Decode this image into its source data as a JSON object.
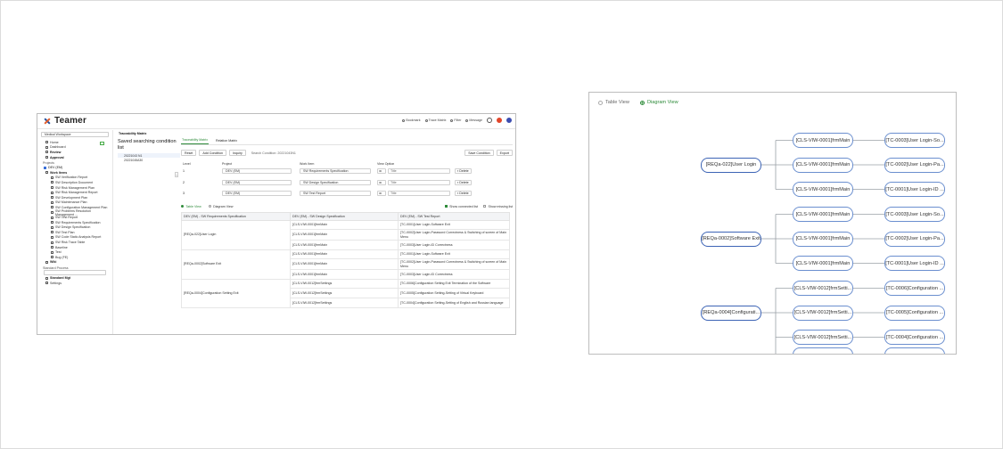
{
  "app": {
    "logo_text": "Teamer",
    "top_nav": [
      "Bookmark",
      "Trace Matrix",
      "Filter",
      "Message"
    ],
    "workspace": "Medical Workspace",
    "nav": [
      "Home",
      "Dashboard",
      "Review",
      "Approval"
    ],
    "projects_label": "Projects",
    "project_name": "DEV (EM)",
    "work_items_label": "Work Items",
    "work_items": [
      "SW Verification Report",
      "SW Description Document",
      "SW Risk Management Plan",
      "SW Risk Management Report",
      "SW Development Plan",
      "SW Maintenance Plan",
      "SW Configuration Management Plan",
      "SW Problems Resolution Management ...",
      "SW Test Report",
      "SW Requirements Specification",
      "SW Design Specification",
      "SW Test Plan",
      "SW Code Static Analysis Report",
      "SW Risk Trace Table",
      "Baseline",
      "Test",
      "Bug (FE)"
    ],
    "wiki": "Wiki",
    "std_process": "Standard Process",
    "std_select": "",
    "std_mgt": "Standard Mgt",
    "settings": "Settings",
    "breadcrumb": "Traceability Matrix",
    "saved": {
      "title": "Saved searching condition list",
      "items": [
        "20221043 N1",
        "20221045A30"
      ]
    },
    "tabs": [
      "Traceability Matrix",
      "Relation Matrix"
    ],
    "buttons": {
      "reset": "Reset",
      "add": "Add Condition",
      "inquiry": "Inquiry",
      "save": "Save Condition",
      "export": "Export"
    },
    "search_condition": "Search Condition: 20221043N1",
    "grid_headers": [
      "Level",
      "Project",
      "Work Item",
      "View Option"
    ],
    "grid_rows": [
      {
        "level": "1",
        "project": "DEV (EM)",
        "work": "SW Requirements Specification",
        "opt": "ID",
        "view": "Title",
        "del": "Delete"
      },
      {
        "level": "2",
        "project": "DEV (EM)",
        "work": "SW Design Specification",
        "opt": "ID",
        "view": "Title",
        "del": "Delete"
      },
      {
        "level": "3",
        "project": "DEV (EM)",
        "work": "SW Test Report",
        "opt": "ID",
        "view": "Title",
        "del": "Delete"
      }
    ],
    "view_toggle": {
      "table": "Table View",
      "diagram": "Diagram View",
      "connected": "Show connected list",
      "missing": "Show missing list"
    },
    "table_headers": [
      "DEV (EM) - SW Requirements Specification",
      "DEV (EM) - SW Design Specification",
      "DEV (EM) - SW Test Report"
    ],
    "table_groups": [
      {
        "req": "[REQa-022]User Login",
        "rows": [
          [
            "[CLS-VIW-0001]frmMain",
            "[TC-0001]User Login-Software Exit"
          ],
          [
            "[CLS-VIW-0001]frmMain",
            "[TC-0002]User Login-Password Correctness & Switching of screen of Main Menu"
          ],
          [
            "[CLS-VIW-0001]frmMain",
            "[TC-0003]User Login-ID Correctness"
          ]
        ]
      },
      {
        "req": "[REQa-0002]Software Exit",
        "rows": [
          [
            "[CLS-VIW-0001]frmMain",
            "[TC-0001]User Login-Software Exit"
          ],
          [
            "[CLS-VIW-0001]frmMain",
            "[TC-0002]User Login-Password Correctness & Switching of screen of Main Menu"
          ],
          [
            "[CLS-VIW-0001]frmMain",
            "[TC-0003]User Login-ID Correctness"
          ]
        ]
      },
      {
        "req": "[REQa-0004]Configuration Setting Exit",
        "rows": [
          [
            "[CLS-VIW-0012]frmSettings",
            "[TC-0006]Configuration Setting Exit Termination of the Software"
          ],
          [
            "[CLS-VIW-0012]frmSettings",
            "[TC-0005]Configuration Setting-Setting of Virtual Keyboard"
          ],
          [
            "[CLS-VIW-0012]frmSettings",
            "[TC-0004]Configuration Setting-Setting of English and Russian language"
          ]
        ]
      }
    ]
  },
  "diagram": {
    "view_toggle": {
      "table": "Table View",
      "diagram": "Diagram View"
    },
    "groups": [
      {
        "req": "[REQa-022]User Login",
        "cls": [
          "[CLS-VIW-0001]frmMain",
          "[CLS-VIW-0001]frmMain",
          "[CLS-VIW-0001]frmMain"
        ],
        "tc": [
          "[TC-0003]User Login-So...",
          "[TC-0002]User Login-Pa...",
          "[TC-0001]User Login-ID ..."
        ]
      },
      {
        "req": "[REQa-0002]Software Exit",
        "cls": [
          "[CLS-VIW-0001]frmMain",
          "[CLS-VIW-0001]frmMain",
          "[CLS-VIW-0001]frmMain"
        ],
        "tc": [
          "[TC-0003]User Login-So...",
          "[TC-0002]User Login-Pa...",
          "[TC-0001]User Login-ID ..."
        ]
      },
      {
        "req": "[REQa-0004]Configurati...",
        "cls": [
          "[CLS-VIW-0012]frmSetti...",
          "[CLS-VIW-0012]frmSetti...",
          "[CLS-VIW-0012]frmSetti..."
        ],
        "tc": [
          "[TC-0006]Configuration ...",
          "[TC-0005]Configuration ...",
          "[TC-0004]Configuration ..."
        ]
      }
    ],
    "colors": {
      "accent": "#2e8b3a",
      "node_border": "#6b8fcf",
      "line": "#9aa0a6"
    }
  }
}
